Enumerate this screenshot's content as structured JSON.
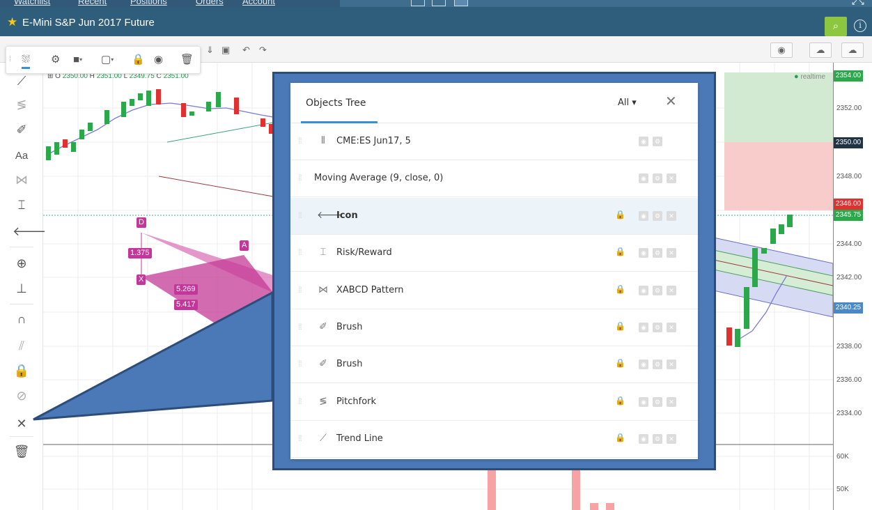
{
  "top_nav": {
    "items": [
      "Watchlist",
      "Recent",
      "Positions",
      "Orders",
      "Account"
    ],
    "expand_icon": "↙↘"
  },
  "header": {
    "symbol_title": "E-Mini S&P Jun 2017 Future",
    "favorite_icon": "★",
    "search_icon": "⌕",
    "info_icon": "i"
  },
  "legend": {
    "open_label": "O",
    "open": "2350.00",
    "high_label": "H",
    "high": "2351.00",
    "low_label": "L",
    "low": "2349.75",
    "close_label": "C",
    "close": "2351.00"
  },
  "realtime_label": "realtime",
  "price_axis": {
    "ticks": [
      "2352.00",
      "2348.00",
      "2344.00",
      "2342.00",
      "2338.00",
      "2336.00",
      "2334.00"
    ],
    "volume_ticks": [
      "60K",
      "50K"
    ],
    "badges": [
      {
        "value": "2354.00",
        "color": "#2ba84a"
      },
      {
        "value": "2350.00",
        "color": "#1f3345"
      },
      {
        "value": "2346.00",
        "color": "#e03030"
      },
      {
        "value": "2345.75",
        "color": "#2ba84a"
      },
      {
        "value": "2340.25",
        "color": "#4d88c6"
      }
    ]
  },
  "pattern_labels": {
    "d": "D",
    "a": "A",
    "x": "X",
    "r1": "1.375",
    "r2": "5.269",
    "r3": "5.417"
  },
  "sidebar": {
    "text_tool_label": "Aa"
  },
  "objects_tree": {
    "title": "Objects Tree",
    "filter_label": "All ▾",
    "close_icon": "✕",
    "rows": [
      {
        "label": "CME:ES Jun17, 5",
        "icon": "candles-icon",
        "selected": false,
        "locked": false,
        "controls": 2
      },
      {
        "label": "Moving Average (9, close, 0)",
        "icon": "",
        "selected": false,
        "locked": false,
        "controls": 3
      },
      {
        "label": "Icon",
        "icon": "arrow-left-icon",
        "selected": true,
        "locked": true,
        "controls": 3
      },
      {
        "label": "Risk/Reward",
        "icon": "risk-reward-icon",
        "selected": false,
        "locked": true,
        "controls": 3
      },
      {
        "label": "XABCD Pattern",
        "icon": "xabcd-pattern-icon",
        "selected": false,
        "locked": true,
        "controls": 3
      },
      {
        "label": "Brush",
        "icon": "brush-icon",
        "selected": false,
        "locked": true,
        "controls": 3
      },
      {
        "label": "Brush",
        "icon": "brush-icon",
        "selected": false,
        "locked": true,
        "controls": 3
      },
      {
        "label": "Pitchfork",
        "icon": "pitchfork-icon",
        "selected": false,
        "locked": true,
        "controls": 3
      },
      {
        "label": "Trend Line",
        "icon": "trend-line-icon",
        "selected": false,
        "locked": true,
        "controls": 3
      }
    ]
  },
  "colors": {
    "header_bg": "#2f5d7c",
    "accent_blue": "#3a8fd1",
    "callout_blue": "#4b78b6",
    "candle_up": "#2ba84a",
    "candle_down": "#e03030",
    "pattern_magenta": "#c4379a"
  }
}
